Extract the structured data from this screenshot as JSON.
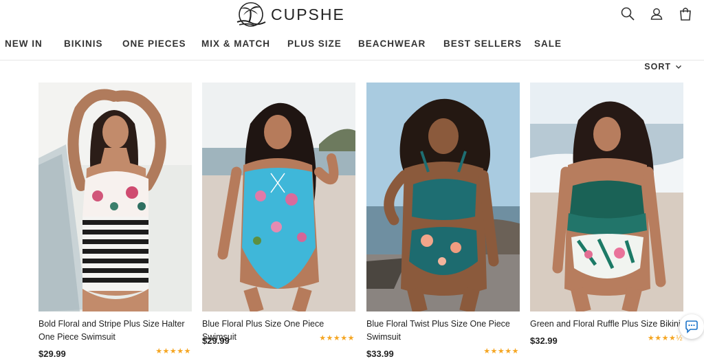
{
  "header": {
    "logo_text": "CUPSHE",
    "icons": [
      "search-icon",
      "account-icon",
      "bag-icon"
    ]
  },
  "nav": {
    "items": [
      {
        "label": "NEW IN"
      },
      {
        "label": "BIKINIS"
      },
      {
        "label": "ONE PIECES"
      },
      {
        "label": "MIX & MATCH"
      },
      {
        "label": "PLUS SIZE"
      },
      {
        "label": "BEACHWEAR"
      },
      {
        "label": "BEST SELLERS"
      },
      {
        "label": "SALE"
      }
    ]
  },
  "toolbar": {
    "sort_label": "SORT"
  },
  "products": [
    {
      "title": "Bold Floral and Stripe Plus Size Halter One Piece Swimsuit",
      "price": "$29.99",
      "rating": 5,
      "stars": "★★★★★"
    },
    {
      "title": "Blue Floral Plus Size One Piece Swimsuit",
      "price": "$29.99",
      "rating": 5,
      "stars": "★★★★★"
    },
    {
      "title": "Blue Floral Twist Plus Size One Piece Swimsuit",
      "price": "$33.99",
      "rating": 5,
      "stars": "★★★★★"
    },
    {
      "title": "Green and Floral Ruffle Plus Size Bikini",
      "price": "$32.99",
      "rating": 4.5,
      "stars": "★★★★½"
    }
  ],
  "colors": {
    "star": "#f5a623",
    "text": "#222222",
    "divider": "#e6e6e6"
  },
  "chat": {
    "icon": "chat-icon"
  }
}
